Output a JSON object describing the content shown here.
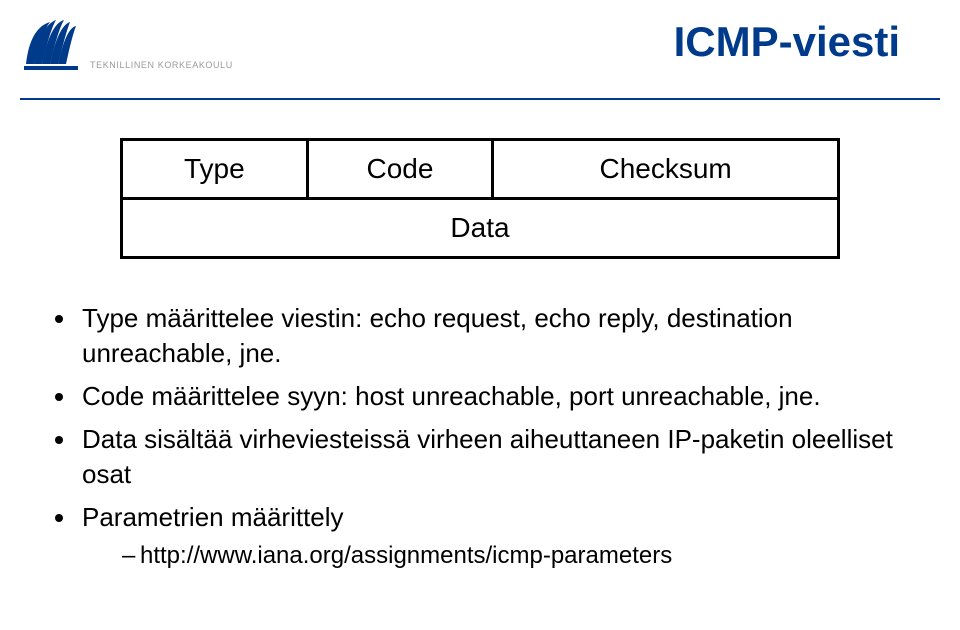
{
  "header": {
    "institution": "TEKNILLINEN KORKEAKOULU",
    "title": "ICMP-viesti"
  },
  "packet": {
    "row1": {
      "type": "Type",
      "code": "Code",
      "checksum": "Checksum"
    },
    "row2": "Data"
  },
  "bullets": [
    "Type määrittelee viestin: echo request, echo reply, destination unreachable, jne.",
    "Code määrittelee syyn: host unreachable, port unreachable, jne.",
    "Data sisältää virheviesteissä virheen aiheuttaneen IP-paketin oleelliset osat",
    "Parametrien määrittely"
  ],
  "subbullet": "http://www.iana.org/assignments/icmp-parameters"
}
